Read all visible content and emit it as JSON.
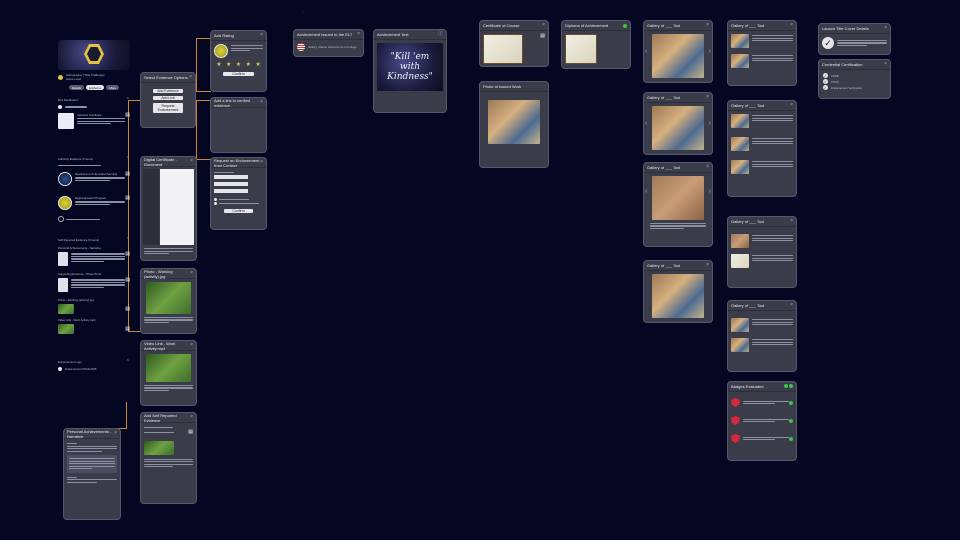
{
  "colors": {
    "background": "#050722",
    "card": "#3a3c4a",
    "connector": "#c88a34",
    "accent_green": "#3dc34a",
    "badge_red": "#d5283a"
  },
  "profile": {
    "name_line1": "Cartographer (Tilde Challenge)",
    "name_line2": "Game Level",
    "tabs": [
      "Details",
      "Evidence",
      "More"
    ],
    "sections": {
      "s1": "Mini Dashboard",
      "s2": "Authority Evidence (3 items)",
      "s3": "Self Reported Evidence (5 items)",
      "s4": "Endorsement Logs"
    },
    "ev_a": "Veterans Certificate",
    "ev_b": "Department of Homeland Security",
    "ev_c": "Regional Award Program",
    "self_1": "Personal Achievements - Narrative",
    "self_2": "Supporting Evidence - Photo Proof",
    "self_3": "Photo - Working (activity).jpg",
    "self_4": "Video Link - Work Activity.mp4",
    "endorse": "Endorsement 05/14/2025"
  },
  "panels": {
    "options": {
      "title": "Select Evidence Options",
      "b1": "Add Evidence",
      "b2": "Add Link",
      "b3": "Request Endorsement"
    },
    "rating": {
      "title": "Add Rating",
      "button": "Confirm"
    },
    "link": {
      "title": "Add a link to verified evidence"
    },
    "request": {
      "title": "Request an Endorsement from Contact",
      "button": "Confirm"
    },
    "doc": {
      "title": "Digital Certificate - Document"
    },
    "photo1": {
      "title": "Photo - Working (activity).jpg"
    },
    "photo2": {
      "title": "Video Link - Work Activity.mp4"
    },
    "add": {
      "title": "Add Self Reported Evidence"
    },
    "narr": {
      "title": "Personal Achievements - Narrative"
    },
    "rel": {
      "title": "Achievement Issued to the ELT",
      "org": "Gallery, Clarion Veterans Go to College"
    },
    "quote": {
      "title": "Achievement Text",
      "text": "\"Kill 'em with Kindness\""
    },
    "cert": {
      "title": "Certificate of Course"
    },
    "proof": {
      "title": "Photo of Issued Work"
    },
    "diploma": {
      "title": "Diploma of Achievement"
    },
    "g1": {
      "title": "Gallery of ___ Tool"
    },
    "g2": {
      "title": "Gallery of ___ Tool"
    },
    "g3": {
      "title": "Gallery of ___ Tool"
    },
    "g4": {
      "title": "Gallery of ___ Tool"
    },
    "l1": {
      "title": "Gallery of ___ Tool"
    },
    "l2": {
      "title": "Gallery of ___ Tool"
    },
    "l3": {
      "title": "Gallery of ___ Tool"
    },
    "l4": {
      "title": "Gallery of ___ Tool"
    },
    "badges": {
      "title": "Badges Evaluated"
    },
    "status": {
      "title": "Launch Title Cover Details"
    },
    "cred": {
      "title": "Credential Certification",
      "items": [
        "CSSB",
        "PCCS",
        "Endorsement Verification"
      ]
    }
  }
}
